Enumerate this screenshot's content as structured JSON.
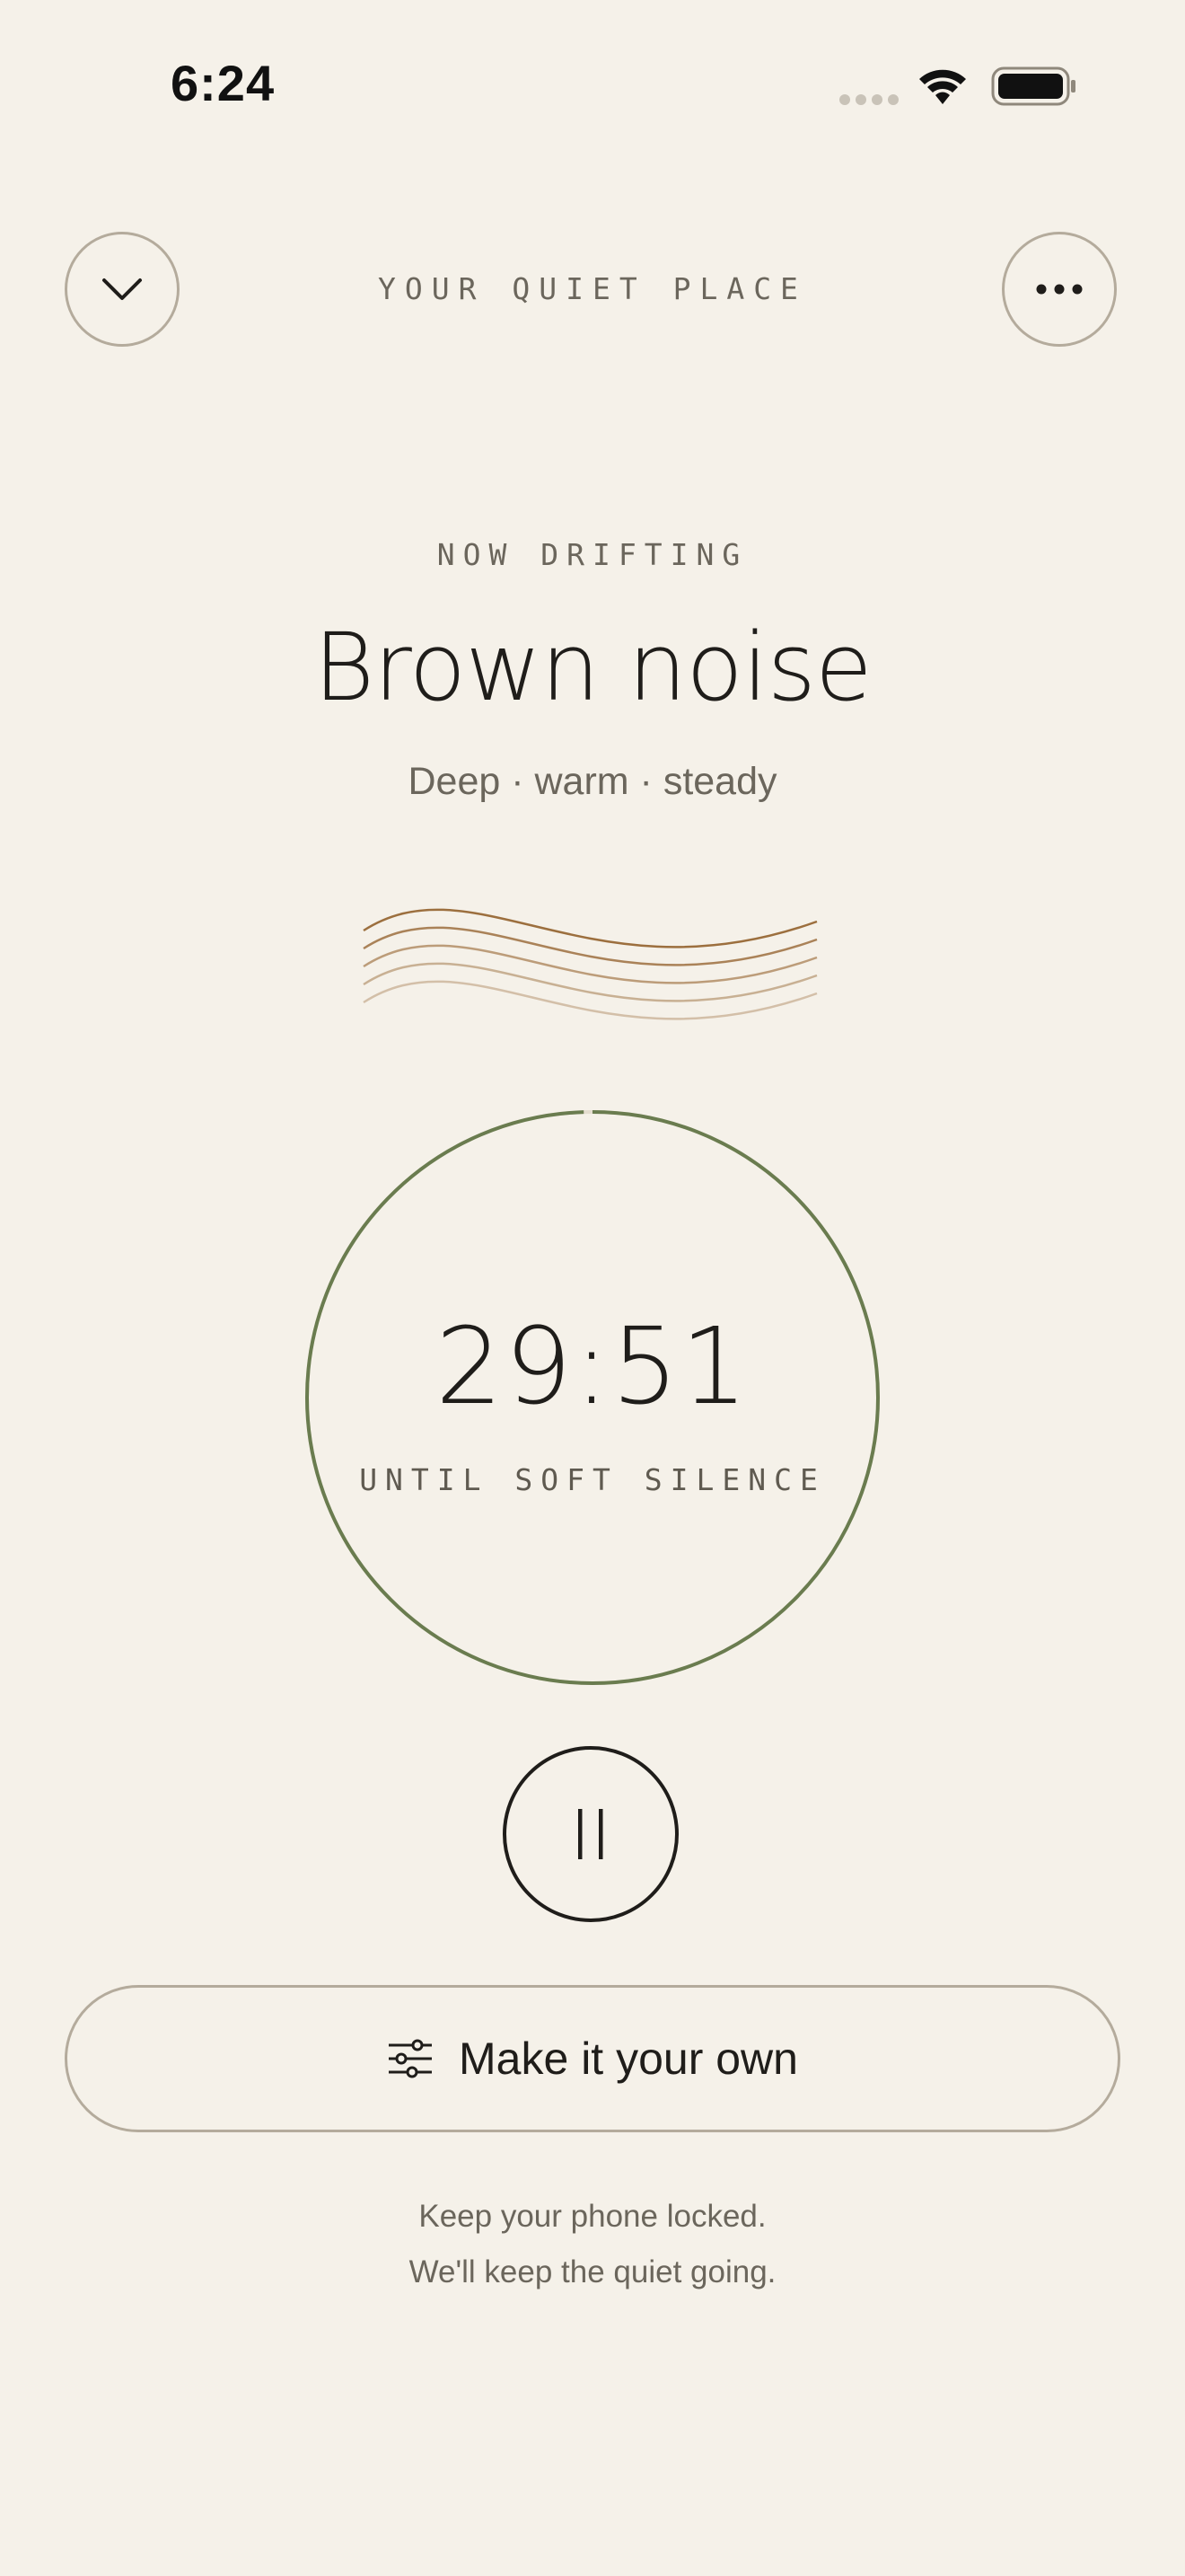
{
  "status_bar": {
    "time": "6:24",
    "icons": [
      "cellular-signal-icon",
      "wifi-icon",
      "battery-icon"
    ]
  },
  "header": {
    "title": "YOUR QUIET PLACE",
    "left_icon": "chevron-down-icon",
    "right_icon": "more-horizontal-icon"
  },
  "now_playing": {
    "eyebrow": "NOW DRIFTING",
    "title": "Brown noise",
    "subtitle": "Deep · warm · steady",
    "wave_icon": "sound-waves-icon"
  },
  "timer": {
    "remaining": "29:51",
    "label": "UNTIL SOFT SILENCE",
    "progress_fraction": 0.995
  },
  "controls": {
    "pause_icon": "pause-icon",
    "customize_icon": "sliders-icon",
    "customize_label": "Make it your own"
  },
  "footer": {
    "line1": "Keep your phone locked.",
    "line2": "We'll keep the quiet going."
  },
  "colors": {
    "background": "#f5f1e9",
    "accent_green": "#6a7c4f",
    "wave_brown": "#9c6f3e",
    "text_primary": "#1f1d1a",
    "text_muted": "#6b665c"
  }
}
